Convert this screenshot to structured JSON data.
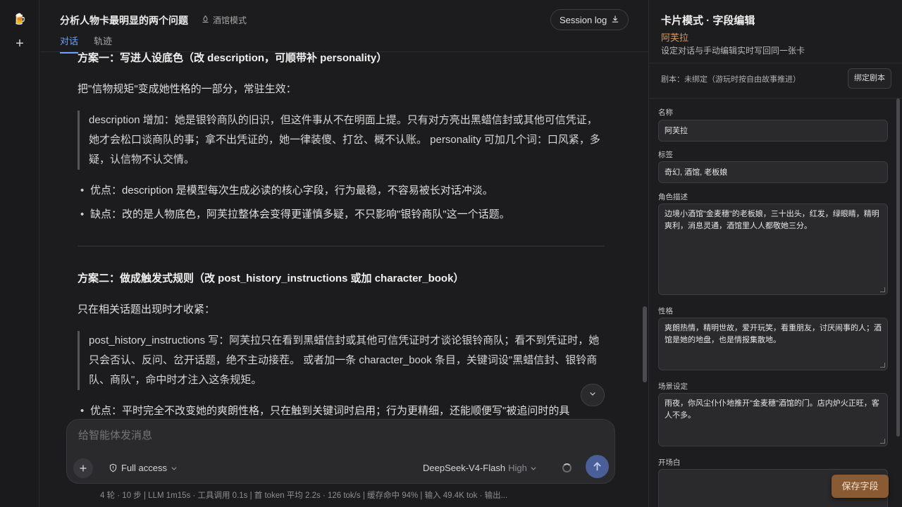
{
  "rail": {
    "logo_icon": "🍺",
    "new_label": "+"
  },
  "header": {
    "title": "分析人物卡最明显的两个问题",
    "mode_label": "酒馆模式",
    "session_log_label": "Session log",
    "tabs": [
      "对话",
      "轨迹"
    ]
  },
  "content": {
    "plan1_heading": "方案一：写进人设底色（改 description，可顺带补 personality）",
    "plan1_intro": "把\"信物规矩\"变成她性格的一部分，常驻生效：",
    "plan1_quote": "description 增加：她是银铃商队的旧识，但这件事从不在明面上提。只有对方亮出黑蜡信封或其他可信凭证，她才会松口谈商队的事；拿不出凭证的，她一律装傻、打岔、概不认账。 personality 可加几个词：口风紧，多疑，认信物不认交情。",
    "plan1_pro": "优点：description 是模型每次生成必读的核心字段，行为最稳，不容易被长对话冲淡。",
    "plan1_con": "缺点：改的是人物底色，阿芙拉整体会变得更谨慎多疑，不只影响\"银铃商队\"这一个话题。",
    "plan2_heading": "方案二：做成触发式规则（改 post_history_instructions 或加 character_book）",
    "plan2_intro": "只在相关话题出现时才收紧：",
    "plan2_quote": "post_history_instructions 写：阿芙拉只在看到黑蜡信封或其他可信凭证时才谈论银铃商队；看不到凭证时，她只会否认、反问、岔开话题，绝不主动接茬。 或者加一条 character_book 条目，关键词设\"黑蜡信封、银铃商队、商队\"，命中时才注入这条规矩。",
    "plan2_pro": "优点：平时完全不改变她的爽朗性格，只在触到关键词时启用；行为更精细，还能顺便写\"被追问时的具"
  },
  "composer": {
    "placeholder": "给智能体发消息",
    "access_label": "Full access",
    "model_name": "DeepSeek-V4-Flash",
    "model_level": "High"
  },
  "stats": "4 轮 · 10 步 | LLM 1m15s · 工具调用 0.1s | 首 token 平均 2.2s · 126 tok/s | 缓存命中 94% | 输入 49.4K tok · 输出...",
  "panel": {
    "title": "卡片模式 · 字段编辑",
    "character_name": "阿芙拉",
    "subtitle": "设定对话与手动编辑实时写回同一张卡",
    "script_label": "剧本：未绑定（游玩时按自由故事推进）",
    "bind_button": "绑定剧本",
    "fields": {
      "name_label": "名称",
      "name_value": "阿芙拉",
      "tags_label": "标签",
      "tags_value": "奇幻, 酒馆, 老板娘",
      "desc_label": "角色描述",
      "desc_value": "边境小酒馆\"金麦穗\"的老板娘，三十出头，红发，绿眼睛，精明爽利，消息灵通，酒馆里人人都敬她三分。",
      "personality_label": "性格",
      "personality_value": "爽朗热情，精明世故，爱开玩笑，看重朋友，讨厌闹事的人；酒馆是她的地盘，也是情报集散地。",
      "scenario_label": "场景设定",
      "scenario_value": "雨夜，你风尘仆仆地推开\"金麦穗\"酒馆的门。店内炉火正旺，客人不多。",
      "greeting_label": "开场白"
    },
    "save_button": "保存字段"
  }
}
